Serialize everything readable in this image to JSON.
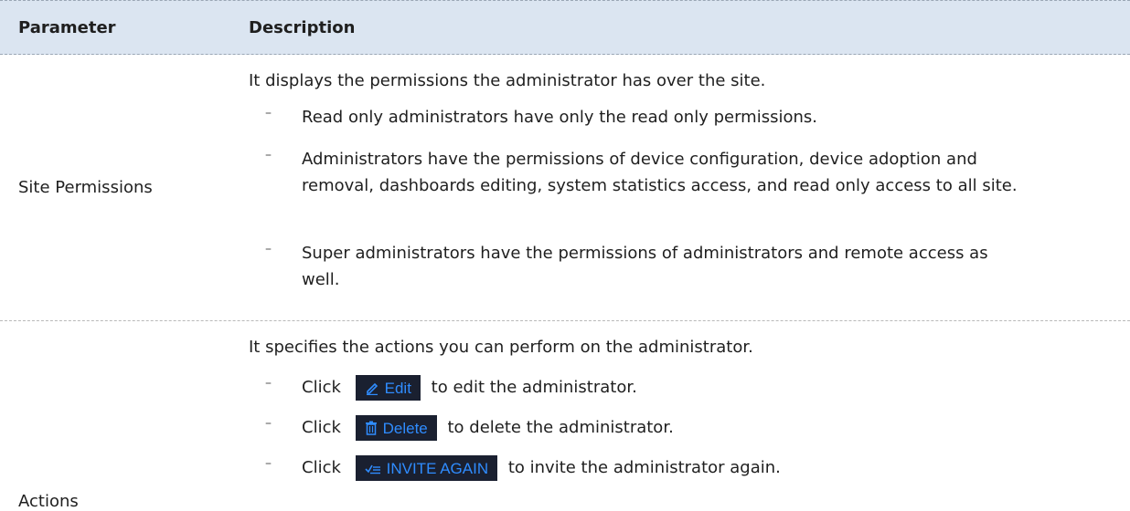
{
  "header": {
    "parameter": "Parameter",
    "description": "Description"
  },
  "site_permissions": {
    "name": "Site Permissions",
    "intro": "It displays the permissions the administrator has over the site.",
    "bullets": [
      "Read only administrators have only the read only permissions.",
      "Administrators have the permissions of device configuration, device adoption and removal, dashboards editing, system statistics access, and read only access to all site.",
      "Super administrators have the permissions of administrators and remote access as well."
    ],
    "dash": "–"
  },
  "actions": {
    "name": "Actions",
    "intro": "It specifies the actions you can perform on the administrator.",
    "click": "Click",
    "edit": {
      "label": "Edit",
      "icon": "edit-pencil-icon",
      "desc": "to edit the administrator."
    },
    "delete": {
      "label": "Delete",
      "icon": "trash-icon",
      "desc": "to delete the administrator."
    },
    "invite": {
      "label": "INVITE AGAIN",
      "icon": "invite-check-icon",
      "desc": "to invite the administrator again."
    },
    "button_bg": "#1a2030",
    "button_fg": "#2f8cff"
  },
  "colors": {
    "header_bg": "#dbe5f1"
  }
}
